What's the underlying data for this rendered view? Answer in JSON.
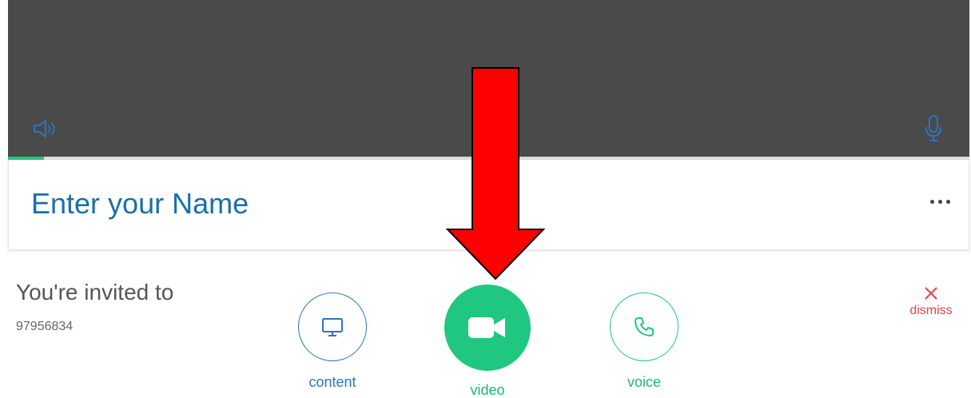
{
  "preview": {
    "speaker_icon": "speaker-icon",
    "mic_icon": "microphone-icon",
    "audio_level": 0.037
  },
  "name_entry": {
    "placeholder": "Enter your Name",
    "more_icon": "more-horizontal-icon"
  },
  "invite": {
    "title": "You're invited to",
    "meeting_id": "97956834"
  },
  "call_options": {
    "content_label": "content",
    "content_icon": "monitor-icon",
    "video_label": "video",
    "video_icon": "video-camera-icon",
    "voice_label": "voice",
    "voice_icon": "phone-icon"
  },
  "dismiss": {
    "label": "dismiss",
    "icon": "close-icon"
  },
  "annotation": {
    "arrow_icon": "down-arrow-annotation",
    "arrow_color": "#ff0000"
  },
  "colors": {
    "brand_green": "#1fc781",
    "brand_blue": "#2d74c0",
    "name_blue": "#1a6fa8",
    "dismiss_red": "#e8434b",
    "preview_bg": "#4a4a4a"
  }
}
